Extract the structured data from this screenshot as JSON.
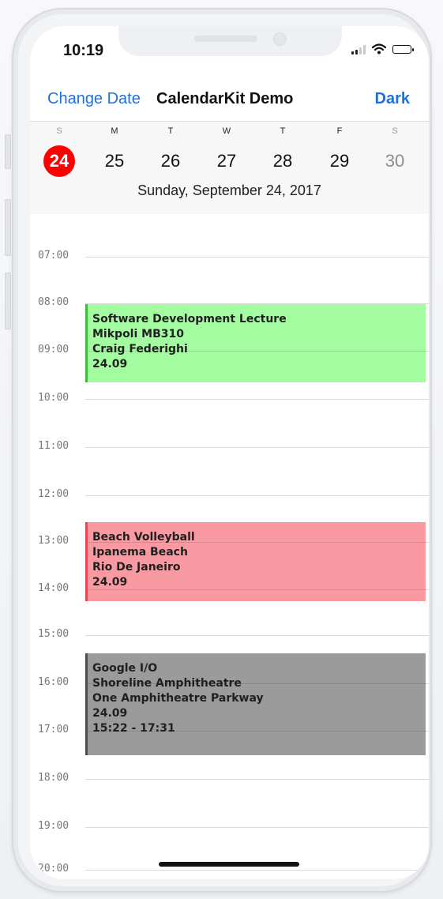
{
  "status_bar": {
    "time": "10:19",
    "icons": [
      "signal-icon",
      "wifi-icon",
      "battery-icon"
    ]
  },
  "nav": {
    "left_button": "Change Date",
    "title": "CalendarKit Demo",
    "right_button": "Dark"
  },
  "week": {
    "days": [
      {
        "letter": "S",
        "number": "24",
        "selected": true
      },
      {
        "letter": "M",
        "number": "25"
      },
      {
        "letter": "T",
        "number": "26"
      },
      {
        "letter": "W",
        "number": "27"
      },
      {
        "letter": "T",
        "number": "28"
      },
      {
        "letter": "F",
        "number": "29"
      },
      {
        "letter": "S",
        "number": "30"
      }
    ],
    "selected_date_label": "Sunday, September 24, 2017"
  },
  "timeline": {
    "hours": [
      "07:00",
      "08:00",
      "09:00",
      "10:00",
      "11:00",
      "12:00",
      "13:00",
      "14:00",
      "15:00",
      "16:00",
      "17:00",
      "18:00",
      "19:00",
      "20:00"
    ]
  },
  "events": [
    {
      "lines": [
        "Software Development Lecture",
        "Mikpoli MB310",
        "Craig Federighi",
        "24.09"
      ]
    },
    {
      "lines": [
        "Beach Volleyball",
        "Ipanema Beach",
        "Rio De Janeiro",
        "24.09"
      ]
    },
    {
      "lines": [
        "Google I/O",
        "Shoreline Amphitheatre",
        "One Amphitheatre Parkway",
        "24.09",
        "15:22 - 17:31"
      ]
    }
  ],
  "colors": {
    "accent": "#1e6fe0",
    "selected_day": "#ff0000",
    "event_green": "#a4fca1",
    "event_red": "#f99aa2",
    "event_gray": "#9b9b9b"
  }
}
